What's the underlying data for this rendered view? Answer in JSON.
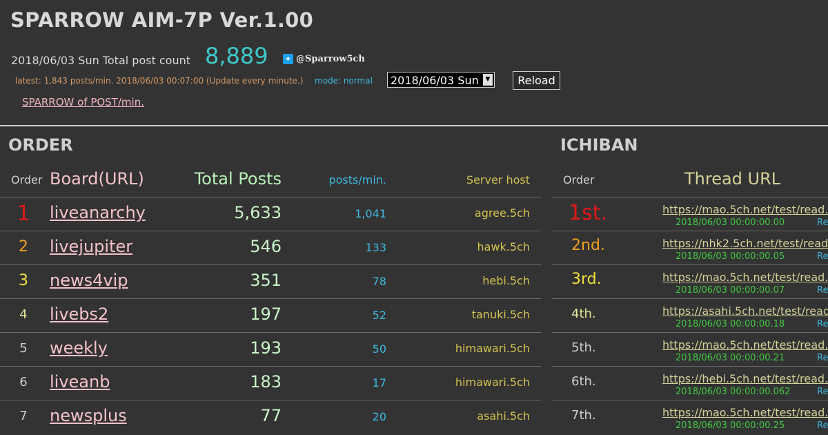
{
  "header": {
    "title": "SPARROW AIM-7P Ver.1.00",
    "date_label": "2018/06/03 Sun Total post count",
    "total_count": "8,889",
    "twitter_handle": "@Sparrow5ch",
    "latest_text": "latest: 1,843 posts/min. 2018/06/03 00:07:00 (Update every minute.)",
    "mode_text": "mode: normal",
    "date_select_value": "2018/06/03 Sun",
    "reload_label": "Reload",
    "postmin_link": "SPARROW of POST/min."
  },
  "order": {
    "section_title": "ORDER",
    "columns": {
      "order": "Order",
      "board": "Board(URL)",
      "total": "Total Posts",
      "ppm": "posts/min.",
      "host": "Server host"
    },
    "rows": [
      {
        "order": "1",
        "board": "liveanarchy",
        "total": "5,633",
        "ppm": "1,041",
        "host": "agree.5ch"
      },
      {
        "order": "2",
        "board": "livejupiter",
        "total": "546",
        "ppm": "133",
        "host": "hawk.5ch"
      },
      {
        "order": "3",
        "board": "news4vip",
        "total": "351",
        "ppm": "78",
        "host": "hebi.5ch"
      },
      {
        "order": "4",
        "board": "livebs2",
        "total": "197",
        "ppm": "52",
        "host": "tanuki.5ch"
      },
      {
        "order": "5",
        "board": "weekly",
        "total": "193",
        "ppm": "50",
        "host": "himawari.5ch"
      },
      {
        "order": "6",
        "board": "liveanb",
        "total": "183",
        "ppm": "17",
        "host": "himawari.5ch"
      },
      {
        "order": "7",
        "board": "newsplus",
        "total": "77",
        "ppm": "20",
        "host": "asahi.5ch"
      }
    ]
  },
  "ichiban": {
    "section_title": "ICHIBAN",
    "columns": {
      "order": "Order",
      "thread": "Thread URL"
    },
    "rows": [
      {
        "order": "1st.",
        "url": "https://mao.5ch.net/test/read.",
        "time": "2018/06/03 00:00:00.00",
        "re": "Re"
      },
      {
        "order": "2nd.",
        "url": "https://nhk2.5ch.net/test/read",
        "time": "2018/06/03 00:00:00.05",
        "re": "Re"
      },
      {
        "order": "3rd.",
        "url": "https://mao.5ch.net/test/read.",
        "time": "2018/06/03 00:00:00.07",
        "re": "Re"
      },
      {
        "order": "4th.",
        "url": "https://asahi.5ch.net/test/read",
        "time": "2018/06/03 00:00:00.18",
        "re": "Re"
      },
      {
        "order": "5th.",
        "url": "https://mao.5ch.net/test/read.",
        "time": "2018/06/03 00:00:00.21",
        "re": "Re"
      },
      {
        "order": "6th.",
        "url": "https://hebi.5ch.net/test/read.",
        "time": "2018/06/03 00:00:00.062",
        "re": "Re"
      },
      {
        "order": "7th.",
        "url": "https://mao.5ch.net/test/read.",
        "time": "2018/06/03 00:00:00.25",
        "re": "Re"
      }
    ]
  },
  "colors": {
    "rank1": "#e01818",
    "rank2": "#f0a020",
    "rank3": "#f0e040",
    "rank4": "#e8e8a0",
    "rank_other": "#cfcfcf"
  }
}
